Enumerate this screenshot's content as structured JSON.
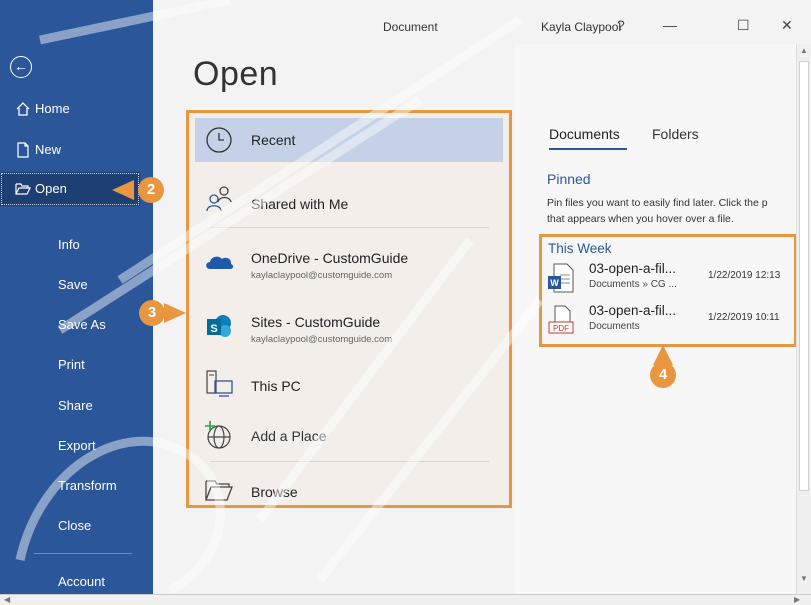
{
  "titlebar": {
    "document": "Document",
    "user": "Kayla Claypool",
    "help": "?",
    "minimize": "—",
    "maximize": "☐",
    "close": "✕"
  },
  "sidebar": {
    "back_glyph": "←",
    "items": [
      {
        "label": "Home",
        "icon": "home-icon"
      },
      {
        "label": "New",
        "icon": "new-document-icon"
      },
      {
        "label": "Open",
        "icon": "folder-open-icon",
        "active": true
      },
      {
        "label": "Info"
      },
      {
        "label": "Save"
      },
      {
        "label": "Save As"
      },
      {
        "label": "Print"
      },
      {
        "label": "Share"
      },
      {
        "label": "Export"
      },
      {
        "label": "Transform"
      },
      {
        "label": "Close"
      },
      {
        "label": "Account"
      }
    ]
  },
  "page_title": "Open",
  "locations": [
    {
      "title": "Recent",
      "icon": "clock-icon",
      "selected": true
    },
    {
      "title": "Shared with Me",
      "icon": "shared-people-icon"
    },
    {
      "title": "OneDrive - CustomGuide",
      "subtitle": "kaylaclaypool@customguide.com",
      "icon": "onedrive-cloud-icon"
    },
    {
      "title": "Sites - CustomGuide",
      "subtitle": "kaylaclaypool@customguide.com",
      "icon": "sharepoint-icon"
    },
    {
      "title": "This PC",
      "icon": "computer-icon"
    },
    {
      "title": "Add a Place",
      "icon": "globe-add-icon"
    },
    {
      "title": "Browse",
      "icon": "folder-icon"
    }
  ],
  "right": {
    "tabs": [
      "Documents",
      "Folders"
    ],
    "pinned_title": "Pinned",
    "pinned_desc_1": "Pin files you want to easily find later. Click the p",
    "pinned_desc_2": "that appears when you hover over a file.",
    "week_title": "This Week",
    "files": [
      {
        "name": "03-open-a-fil...",
        "path": "Documents » CG ...",
        "date": "1/22/2019 12:13",
        "icon": "word-file-icon"
      },
      {
        "name": "03-open-a-fil...",
        "path": "Documents",
        "date": "1/22/2019 10:11",
        "icon": "pdf-file-icon",
        "badge": "PDF"
      }
    ]
  },
  "callouts": [
    "2",
    "3",
    "4"
  ],
  "colors": {
    "sidebar": "#2b579a",
    "accent": "#e8963f",
    "link": "#2b579a"
  }
}
